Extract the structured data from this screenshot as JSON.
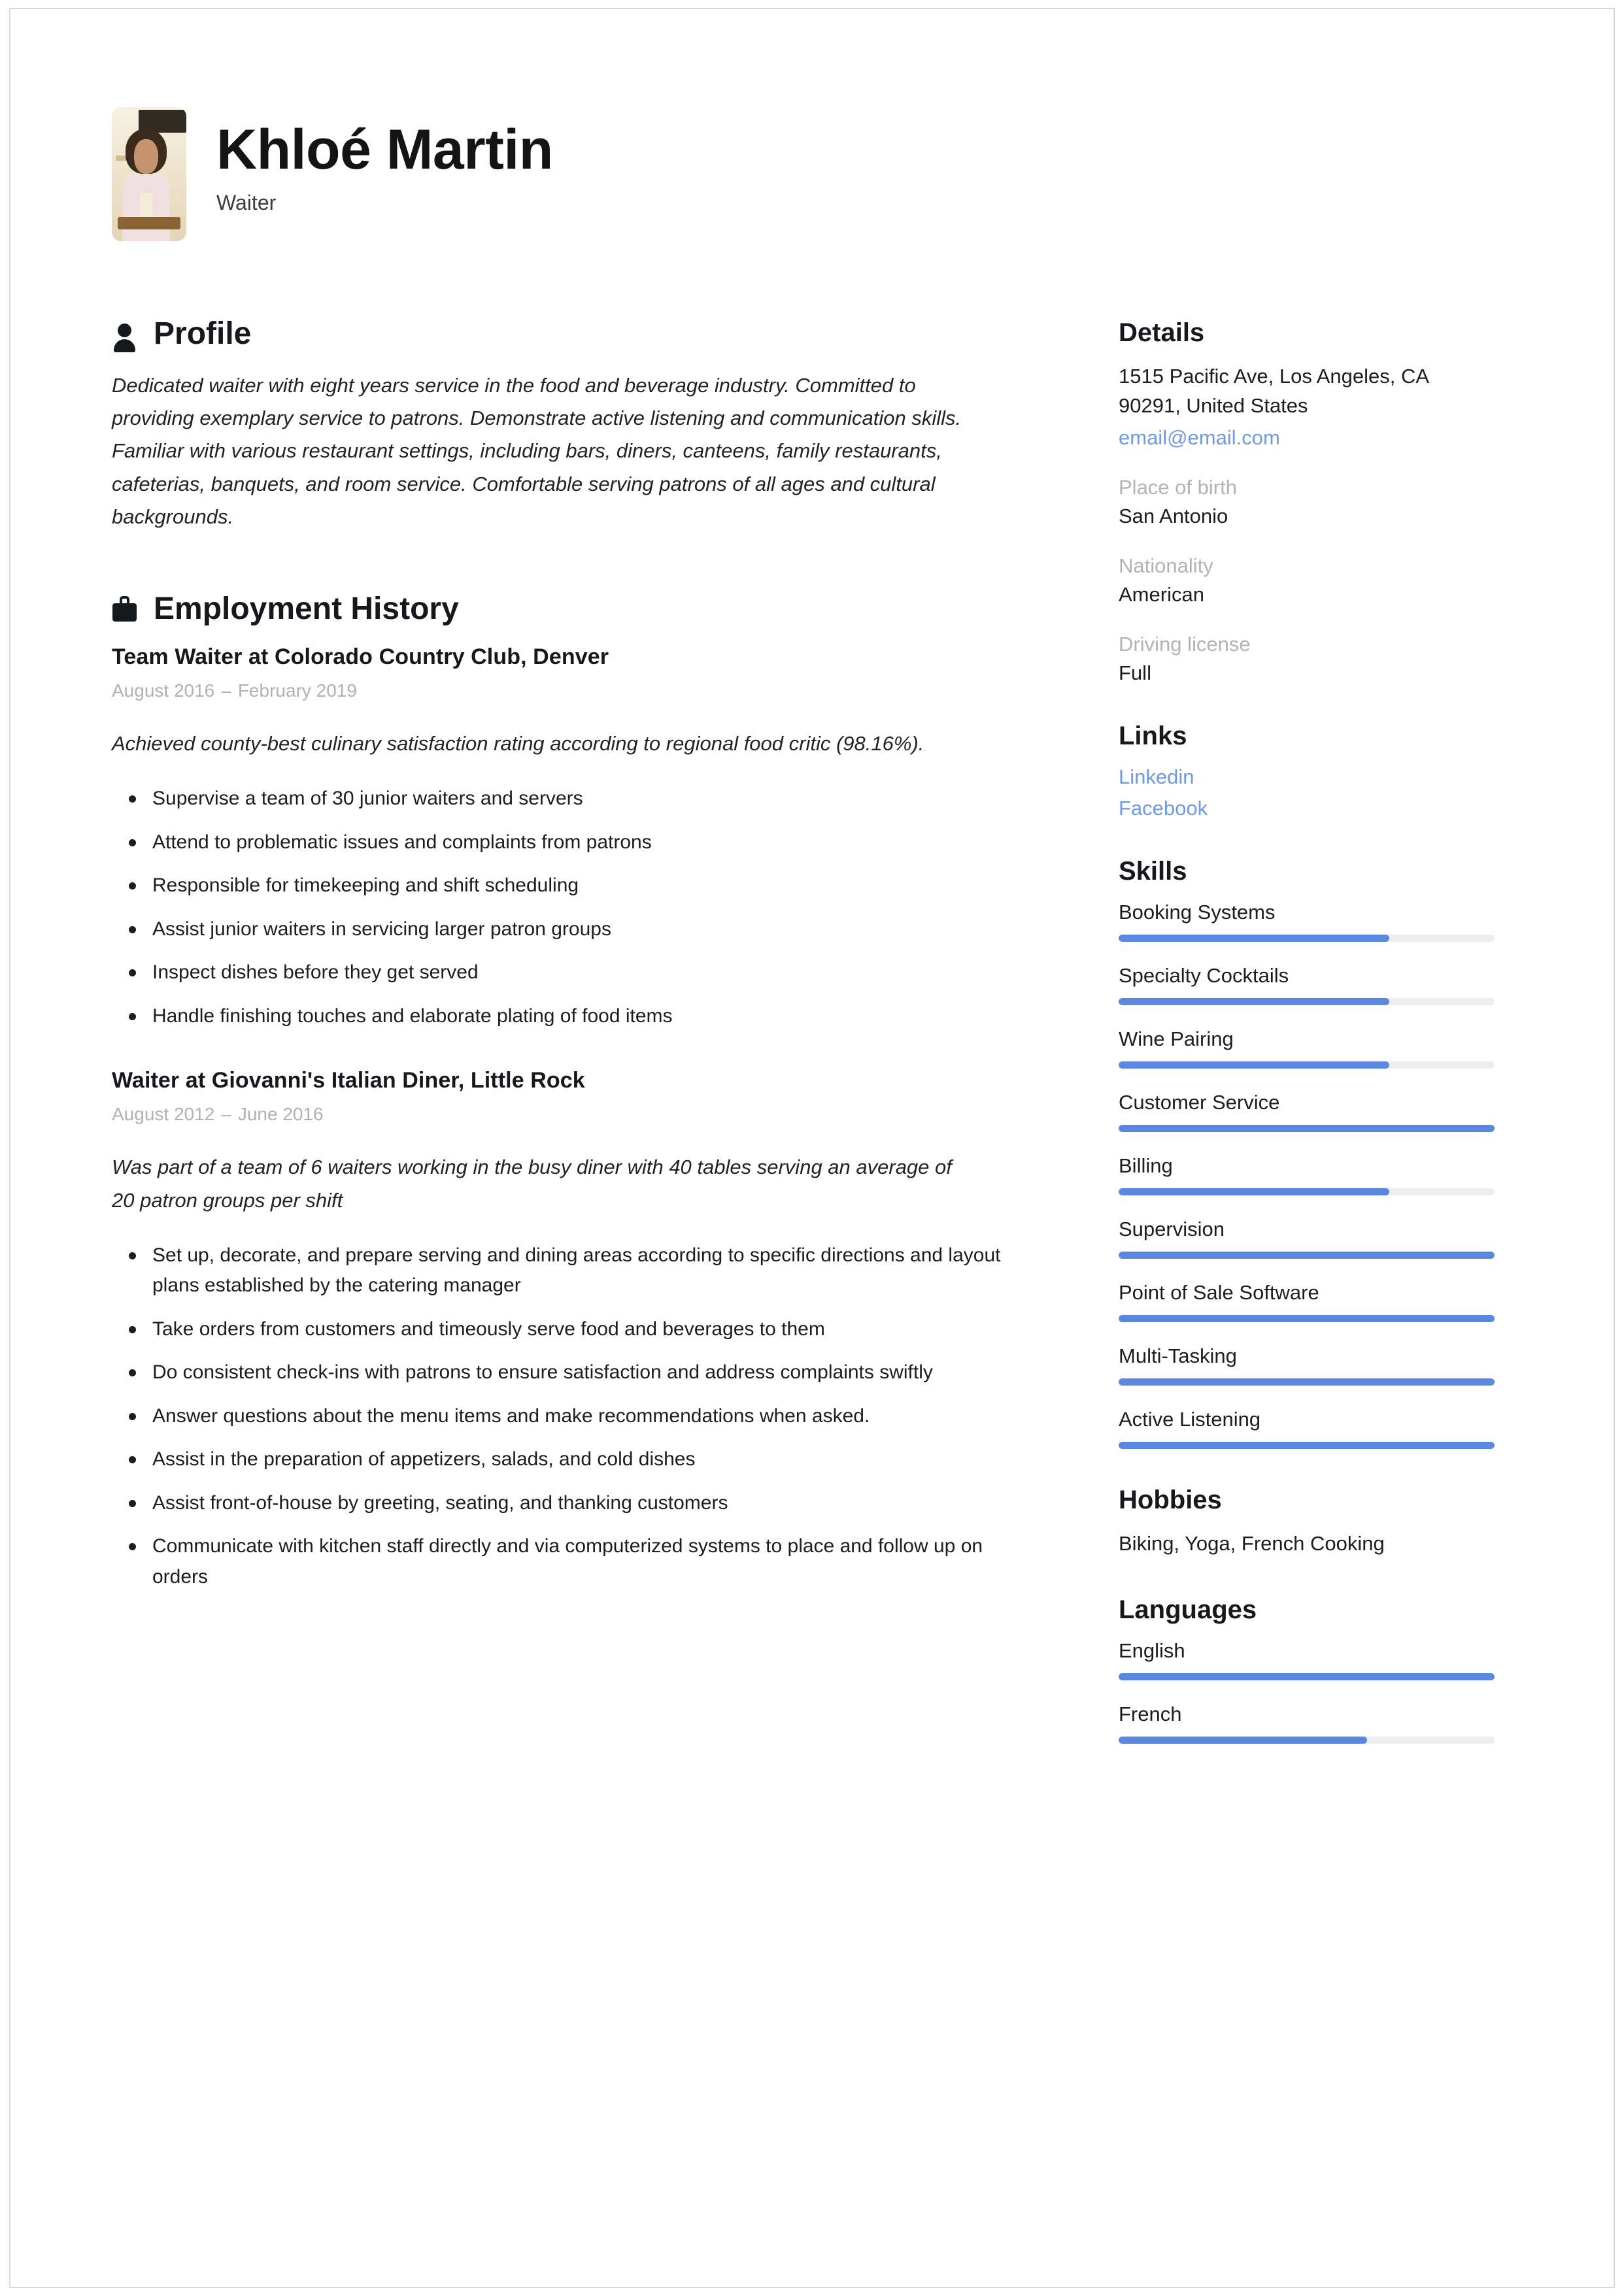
{
  "header": {
    "name": "Khloé Martin",
    "job_title": "Waiter",
    "photo_alt": "profile-photo"
  },
  "main": {
    "profile": {
      "heading": "Profile",
      "icon": "person-icon",
      "text": "Dedicated waiter with eight years service in the food and beverage industry. Committed to providing exemplary service to patrons. Demonstrate active listening and communication skills. Familiar with various restaurant settings, including bars, diners, canteens, family restaurants, cafeterias, banquets, and room service. Comfortable serving patrons of all ages and cultural backgrounds."
    },
    "employment": {
      "heading": "Employment History",
      "icon": "briefcase-icon",
      "jobs": [
        {
          "role": "Team Waiter at Colorado Country Club, Denver",
          "start": "August 2016",
          "dash": "–",
          "end": "February 2019",
          "summary": "Achieved county-best culinary satisfaction rating according to regional food critic (98.16%).",
          "bullets": [
            "Supervise a team of 30 junior waiters and servers",
            "Attend to problematic issues and complaints from patrons",
            "Responsible for timekeeping and shift scheduling",
            "Assist junior waiters in servicing larger patron groups",
            "Inspect dishes before they get served",
            "Handle finishing touches and elaborate plating of food items"
          ]
        },
        {
          "role": "Waiter at Giovanni's Italian Diner, Little Rock",
          "start": "August 2012",
          "dash": "–",
          "end": "June 2016",
          "summary": "Was part of a team of 6 waiters working in the busy diner with 40 tables serving an average of 20 patron groups per shift",
          "bullets": [
            "Set up, decorate, and prepare serving and dining areas according to specific directions and layout plans established by the catering manager",
            "Take orders from customers and timeously serve food and beverages to them",
            "Do consistent check-ins with patrons to ensure satisfaction and address complaints swiftly",
            "Answer questions about the menu items and make recommendations when asked.",
            "Assist in the preparation of appetizers, salads, and cold dishes",
            "Assist front-of-house by greeting, seating, and thanking customers",
            "Communicate with kitchen staff directly and via computerized systems to place and follow up on orders"
          ]
        }
      ]
    }
  },
  "sidebar": {
    "details": {
      "heading": "Details",
      "address_line1": "1515 Pacific Ave, Los Angeles, CA",
      "address_line2": "90291, United States",
      "email": "email@email.com",
      "fields": [
        {
          "label": "Place of birth",
          "value": "San Antonio"
        },
        {
          "label": "Nationality",
          "value": "American"
        },
        {
          "label": "Driving license",
          "value": "Full"
        }
      ]
    },
    "links": {
      "heading": "Links",
      "items": [
        {
          "label": "Linkedin"
        },
        {
          "label": "Facebook"
        }
      ]
    },
    "skills": {
      "heading": "Skills",
      "items": [
        {
          "label": "Booking Systems",
          "level": 72
        },
        {
          "label": "Specialty Cocktails",
          "level": 72
        },
        {
          "label": "Wine Pairing",
          "level": 72
        },
        {
          "label": "Customer Service",
          "level": 100
        },
        {
          "label": "Billing",
          "level": 72
        },
        {
          "label": "Supervision",
          "level": 100
        },
        {
          "label": "Point of Sale Software",
          "level": 100
        },
        {
          "label": "Multi-Tasking",
          "level": 100
        },
        {
          "label": "Active Listening",
          "level": 100
        }
      ]
    },
    "hobbies": {
      "heading": "Hobbies",
      "text": "Biking, Yoga, French Cooking"
    },
    "languages": {
      "heading": "Languages",
      "items": [
        {
          "label": "English",
          "level": 100
        },
        {
          "label": "French",
          "level": 66
        }
      ]
    }
  },
  "colors": {
    "accent": "#5a87e0",
    "link": "#6d9ae0",
    "track": "#f0eeec",
    "muted": "#b3b3b3",
    "text": "#1d1d1d"
  }
}
